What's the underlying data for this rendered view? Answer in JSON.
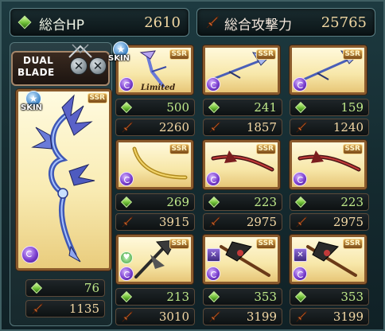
{
  "header": {
    "hp_label": "総合HP",
    "hp_value": "2610",
    "atk_label": "総合攻撃力",
    "atk_value": "25765"
  },
  "main_weapon": {
    "dual_label_line1": "DUAL",
    "dual_label_line2": "BLADE",
    "skin_label": "SKIN",
    "rarity": "SSR",
    "hp": "76",
    "atk": "1135"
  },
  "grid": [
    {
      "id": "w1",
      "rarity": "SSR",
      "hp": "500",
      "atk": "2260",
      "badge": "skin",
      "skin_label": "SKIN",
      "tag": "Limited",
      "element_icon": "dark-element-icon"
    },
    {
      "id": "w2",
      "rarity": "SSR",
      "hp": "241",
      "atk": "1857",
      "badge": "",
      "tag": "",
      "element_icon": "dark-element-icon"
    },
    {
      "id": "w3",
      "rarity": "SSR",
      "hp": "159",
      "atk": "1240",
      "badge": "",
      "tag": "",
      "element_icon": "dark-element-icon"
    },
    {
      "id": "w4",
      "rarity": "SSR",
      "hp": "269",
      "atk": "3915",
      "badge": "",
      "tag": "",
      "element_icon": "dark-element-icon"
    },
    {
      "id": "w5",
      "rarity": "SSR",
      "hp": "223",
      "atk": "2975",
      "badge": "",
      "tag": "",
      "element_icon": "dark-element-icon"
    },
    {
      "id": "w6",
      "rarity": "SSR",
      "hp": "223",
      "atk": "2975",
      "badge": "",
      "tag": "",
      "element_icon": "dark-element-icon"
    },
    {
      "id": "w7",
      "rarity": "SSR",
      "hp": "213",
      "atk": "3010",
      "badge": "heart",
      "tag": "",
      "element_icon": "dark-element-icon"
    },
    {
      "id": "w8",
      "rarity": "SSR",
      "hp": "353",
      "atk": "3199",
      "badge": "axe",
      "tag": "",
      "element_icon": "dark-element-icon"
    },
    {
      "id": "w9",
      "rarity": "SSR",
      "hp": "353",
      "atk": "3199",
      "badge": "axe",
      "tag": "",
      "element_icon": "dark-element-icon"
    }
  ],
  "icons": {
    "hp": "hp-gem-icon",
    "atk": "attack-sword-icon",
    "element": "dark-element-icon",
    "skin": "skin-star-icon"
  },
  "colors": {
    "hp_text": "#bfe98a",
    "atk_text": "#f2d7a4",
    "card_border": "#8a5a2c",
    "panel_bg": "#14292e"
  }
}
